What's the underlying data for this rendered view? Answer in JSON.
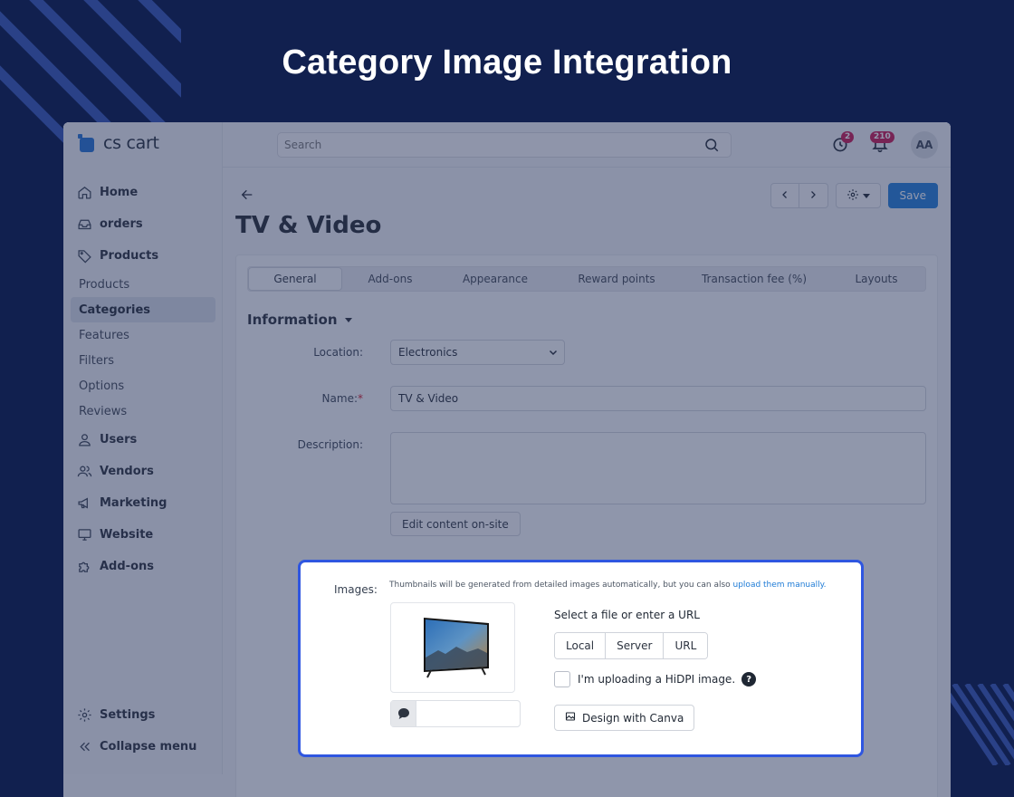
{
  "banner": {
    "title": "Category Image Integration"
  },
  "brand": {
    "logo_text": "cs cart",
    "accent": "#1e6fd0"
  },
  "header": {
    "search_placeholder": "Search",
    "notifications_count": "2",
    "alerts_count": "210",
    "avatar_initials": "AA"
  },
  "sidebar": {
    "items": [
      {
        "label": "Home",
        "icon": "home-icon"
      },
      {
        "label": "orders",
        "icon": "inbox-icon"
      },
      {
        "label": "Products",
        "icon": "tag-icon"
      }
    ],
    "sub_items": [
      "Products",
      "Categories",
      "Features",
      "Filters",
      "Options",
      "Reviews"
    ],
    "active_sub": "Categories",
    "items_after": [
      {
        "label": "Users",
        "icon": "user-icon"
      },
      {
        "label": "Vendors",
        "icon": "users-icon"
      },
      {
        "label": "Marketing",
        "icon": "megaphone-icon"
      },
      {
        "label": "Website",
        "icon": "monitor-icon"
      },
      {
        "label": "Add-ons",
        "icon": "puzzle-icon"
      }
    ],
    "bottom": [
      {
        "label": "Settings",
        "icon": "gear-icon"
      },
      {
        "label": "Collapse menu",
        "icon": "double-chevron-left-icon"
      }
    ]
  },
  "toolbar": {
    "save_label": "Save"
  },
  "page": {
    "title": "TV & Video"
  },
  "tabs": [
    "General",
    "Add-ons",
    "Appearance",
    "Reward points",
    "Transaction fee (%)",
    "Layouts"
  ],
  "active_tab": "General",
  "form": {
    "section_title": "Information",
    "location_label": "Location:",
    "location_value": "Electronics",
    "name_label": "Name:",
    "name_required": "*",
    "name_value": "TV & Video",
    "description_label": "Description:",
    "edit_onsite_label": "Edit content on-site"
  },
  "images": {
    "label": "Images:",
    "note": "Thumbnails will be generated from detailed images automatically, but you can also ",
    "note_link": "upload them manually.",
    "select_text": "Select a file or enter a URL",
    "sources": [
      "Local",
      "Server",
      "URL"
    ],
    "hidpi_label": "I'm uploading a HiDPI image.",
    "help_mark": "?",
    "canva_label": "Design with Canva",
    "highlight_color": "#2f56e0"
  }
}
